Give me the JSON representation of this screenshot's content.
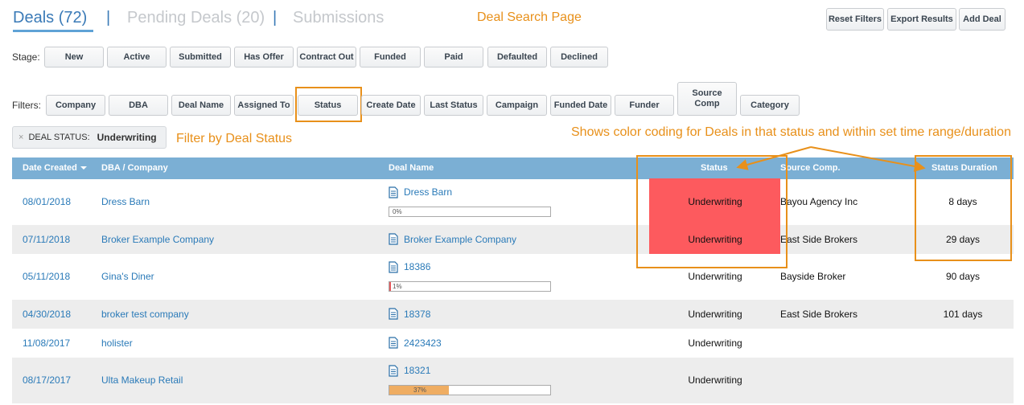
{
  "tabs": {
    "deals": "Deals (72)",
    "separator": "|",
    "pending": "Pending Deals (20)",
    "submissions": "Submissions"
  },
  "annotations": {
    "page": "Deal Search Page",
    "filter": "Filter by Deal Status",
    "color_coding": "Shows color coding for Deals in that status and within set time range/duration",
    "color": "#e8901a"
  },
  "actions": {
    "reset": "Reset Filters",
    "export": "Export Results",
    "add": "Add Deal"
  },
  "stage": {
    "label": "Stage:",
    "buttons": [
      "New",
      "Active",
      "Submitted",
      "Has Offer",
      "Contract Out",
      "Funded",
      "Paid",
      "Defaulted",
      "Declined"
    ]
  },
  "filters": {
    "label": "Filters:",
    "buttons": [
      "Company",
      "DBA",
      "Deal Name",
      "Assigned To",
      "Status",
      "Create Date",
      "Last Status",
      "Campaign",
      "Funded Date",
      "Funder",
      "Source Comp",
      "Category"
    ]
  },
  "chip": {
    "remove": "×",
    "label": "DEAL STATUS:",
    "value": "Underwriting"
  },
  "table": {
    "headers": {
      "date_created": "Date Created",
      "dba_company": "DBA / Company",
      "deal_name": "Deal Name",
      "status": "Status",
      "source_comp": "Source Comp.",
      "status_duration": "Status Duration"
    },
    "rows": [
      {
        "date": "08/01/2018",
        "company": "Dress Barn",
        "deal": "Dress Barn",
        "progress_label": "0%",
        "progress": 0,
        "status": "Underwriting",
        "source": "Bayou Agency Inc",
        "duration": "8 days"
      },
      {
        "date": "07/11/2018",
        "company": "Broker Example Company",
        "deal": "Broker Example Company",
        "progress_label": "",
        "progress": null,
        "status": "Underwriting",
        "source": "East Side Brokers",
        "duration": "29 days"
      },
      {
        "date": "05/11/2018",
        "company": "Gina's Diner",
        "deal": "18386",
        "progress_label": "1%",
        "progress": 0.01,
        "status": "Underwriting",
        "source": "Bayside Broker",
        "duration": "90 days"
      },
      {
        "date": "04/30/2018",
        "company": "broker test company",
        "deal": "18378",
        "progress_label": "",
        "progress": null,
        "status": "Underwriting",
        "source": "East Side Brokers",
        "duration": "101 days"
      },
      {
        "date": "11/08/2017",
        "company": "holister",
        "deal": "2423423",
        "progress_label": "",
        "progress": null,
        "status": "Underwriting",
        "source": "",
        "duration": ""
      },
      {
        "date": "08/17/2017",
        "company": "Ulta Makeup Retail",
        "deal": "18321",
        "progress_label": "37%",
        "progress": 0.37,
        "status": "Underwriting",
        "source": "",
        "duration": ""
      }
    ],
    "status_highlight_color": "#fd5a5e"
  }
}
